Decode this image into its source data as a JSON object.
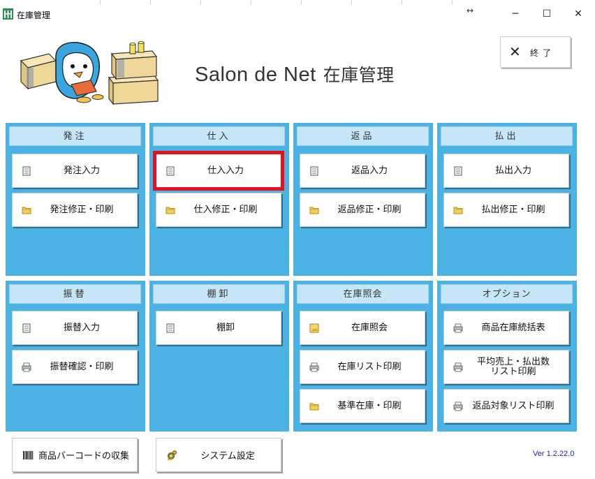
{
  "window": {
    "title": "在庫管理",
    "resize_hint": "↔",
    "controls": {
      "minimize": "─",
      "maximize": "☐",
      "close": "✕"
    }
  },
  "header": {
    "title_latin": "Salon de Net",
    "title_jp": "在庫管理",
    "exit_icon": "✕",
    "exit_label": "終了"
  },
  "panels": {
    "order": {
      "title": "発注",
      "buttons": [
        {
          "label": "発注入力",
          "icon": "document-icon"
        },
        {
          "label": "発注修正・印刷",
          "icon": "folder-icon"
        }
      ]
    },
    "purchase": {
      "title": "仕入",
      "buttons": [
        {
          "label": "仕入入力",
          "icon": "document-icon",
          "selected": true
        },
        {
          "label": "仕入修正・印刷",
          "icon": "folder-icon"
        }
      ]
    },
    "returns": {
      "title": "返品",
      "buttons": [
        {
          "label": "返品入力",
          "icon": "document-icon"
        },
        {
          "label": "返品修正・印刷",
          "icon": "folder-icon"
        }
      ]
    },
    "payout": {
      "title": "払出",
      "buttons": [
        {
          "label": "払出入力",
          "icon": "document-icon"
        },
        {
          "label": "払出修正・印刷",
          "icon": "folder-icon"
        }
      ]
    },
    "transfer": {
      "title": "振替",
      "buttons": [
        {
          "label": "振替入力",
          "icon": "document-icon"
        },
        {
          "label": "振替確認・印刷",
          "icon": "printer-icon"
        }
      ]
    },
    "stocktake": {
      "title": "棚卸",
      "buttons": [
        {
          "label": "棚卸",
          "icon": "document-icon"
        }
      ]
    },
    "inquiry": {
      "title": "在庫照会",
      "buttons": [
        {
          "label": "在庫照会",
          "icon": "image-icon"
        },
        {
          "label": "在庫リスト印刷",
          "icon": "printer-icon"
        },
        {
          "label": "基準在庫・印刷",
          "icon": "folder-icon"
        }
      ]
    },
    "options": {
      "title": "オプション",
      "buttons": [
        {
          "label": "商品在庫統括表",
          "icon": "printer-icon"
        },
        {
          "label": "平均売上・払出数\nリスト印刷",
          "icon": "printer-icon"
        },
        {
          "label": "返品対象リスト印刷",
          "icon": "printer-icon"
        }
      ]
    }
  },
  "footer": {
    "barcode_button": "商品バーコードの収集",
    "settings_button": "システム設定",
    "version": "Ver 1.2.22.0"
  },
  "colors": {
    "panel_bg": "#4bb3e3",
    "panel_header": "#c5e6f6",
    "selected_outline": "#e8101a"
  }
}
